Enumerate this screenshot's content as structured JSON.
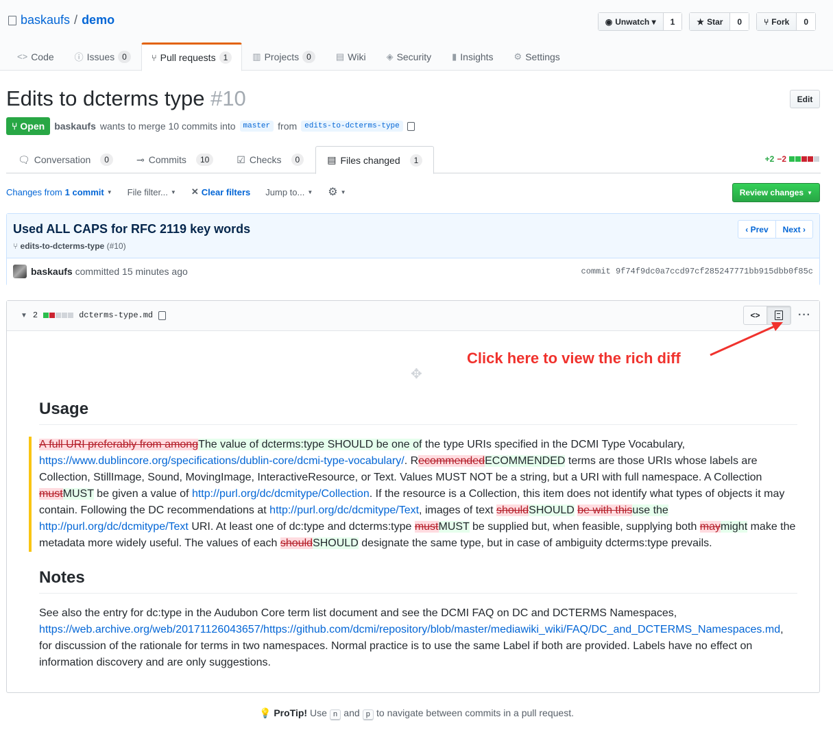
{
  "repo": {
    "owner": "baskaufs",
    "sep": "/",
    "name": "demo"
  },
  "actions": {
    "watch": {
      "label": "Unwatch ▾",
      "count": "1"
    },
    "star": {
      "label": "Star",
      "count": "0"
    },
    "fork": {
      "label": "Fork",
      "count": "0"
    }
  },
  "reponav": [
    {
      "label": "Code",
      "icon": "<>"
    },
    {
      "label": "Issues",
      "icon": "ⓘ",
      "count": "0"
    },
    {
      "label": "Pull requests",
      "icon": "⑂",
      "count": "1"
    },
    {
      "label": "Projects",
      "icon": "▥",
      "count": "0"
    },
    {
      "label": "Wiki",
      "icon": "▤"
    },
    {
      "label": "Security",
      "icon": "◈"
    },
    {
      "label": "Insights",
      "icon": "▮"
    },
    {
      "label": "Settings",
      "icon": "⚙"
    }
  ],
  "pr": {
    "title": "Edits to dcterms type",
    "number": "#10",
    "edit_label": "Edit",
    "state": "Open",
    "author": "baskaufs",
    "merge_text": "wants to merge 10 commits into",
    "base": "master",
    "from_text": "from",
    "head": "edits-to-dcterms-type"
  },
  "tabs": [
    {
      "label": "Conversation",
      "count": "0"
    },
    {
      "label": "Commits",
      "count": "10"
    },
    {
      "label": "Checks",
      "count": "0"
    },
    {
      "label": "Files changed",
      "count": "1"
    }
  ],
  "diffstat": {
    "add": "+2",
    "del": "−2"
  },
  "toolbar": {
    "changes_prefix": "Changes from",
    "changes_bold": "1 commit",
    "file_filter": "File filter...",
    "clear_filters": "Clear filters",
    "jump_to": "Jump to...",
    "review": "Review changes"
  },
  "commit": {
    "title": "Used ALL CAPS for RFC 2119 key words",
    "branch": "edits-to-dcterms-type",
    "pr_ref": "(#10)",
    "prev": "‹ Prev",
    "next": "Next ›",
    "author": "baskaufs",
    "committed_text": "committed 15 minutes ago",
    "sha_label": "commit",
    "sha": "9f74f9dc0a7ccd97cf285247771bb915dbb0f85c"
  },
  "file": {
    "changes": "2",
    "name": "dcterms-type.md"
  },
  "annotation": "Click here to view the rich diff",
  "doc": {
    "usage_heading": "Usage",
    "notes_heading": "Notes",
    "usage": {
      "del1": "A full URI preferably from among",
      "ins1": "The value of dcterms:type SHOULD be one of",
      "t1": " the type URIs specified in the DCMI Type Vocabulary, ",
      "link1": "https://www.dublincore.org/specifications/dublin-core/dcmi-type-vocabulary/",
      "t2": ". R",
      "del2": "ecommended",
      "ins2": "ECOMMENDED",
      "t3": " terms are those URIs whose labels are Collection, StillImage, Sound, MovingImage, InteractiveResource, or Text. Values MUST NOT be a string, but a URI with full namespace. A Collection ",
      "del3": "must",
      "ins3": "MUST",
      "t4": " be given a value of ",
      "link2": "http://purl.org/dc/dcmitype/Collection",
      "t5": ". If the resource is a Collection, this item does not identify what types of objects it may contain. Following the DC recommendations at ",
      "link3": "http://purl.org/dc/dcmitype/Text",
      "t6": ", images of text ",
      "del4": "should",
      "ins4": "SHOULD",
      "t7": " ",
      "del5": "be with this",
      "ins5": "use the",
      "t8": " ",
      "link4": "http://purl.org/dc/dcmitype/Text",
      "t9": " URI. At least one of dc:type and dcterms:type ",
      "del6": "must",
      "ins6": "MUST",
      "t10": " be supplied but, when feasible, supplying both ",
      "del7": "may",
      "ins7": "might",
      "t11": " make the metadata more widely useful. The values of each ",
      "del8": "should",
      "ins8": "SHOULD",
      "t12": " designate the same type, but in case of ambiguity dcterms:type prevails."
    },
    "notes": {
      "t1": "See also the entry for dc:type in the Audubon Core term list document and see the DCMI FAQ on DC and DCTERMS Namespaces, ",
      "link1": "https://web.archive.org/web/20171126043657/https://github.com/dcmi/repository/blob/master/mediawiki_wiki/FAQ/DC_and_DCTERMS_Namespaces.md",
      "t2": ", for discussion of the rationale for terms in two namespaces. Normal practice is to use the same Label if both are provided. Labels have no effect on information discovery and are only suggestions."
    }
  },
  "protip": {
    "bold": "ProTip!",
    "t1": " Use ",
    "k1": "n",
    "t2": " and ",
    "k2": "p",
    "t3": " to navigate between commits in a pull request."
  },
  "colors": {
    "accent": "#0366d6",
    "open": "#28a745",
    "annotation": "#f0322d",
    "changed_bar": "#f9c513"
  }
}
